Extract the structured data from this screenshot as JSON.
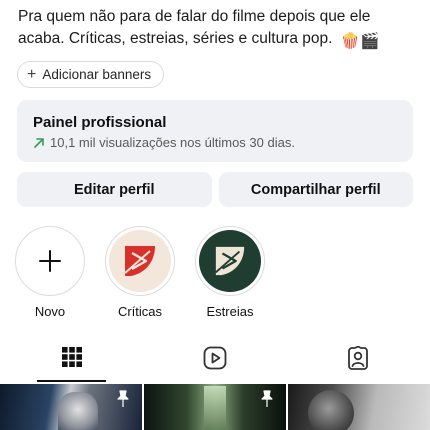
{
  "profile": {
    "bio_text": "Pra quem não para de falar do filme depois que ele acaba. Críticas, estreias, séries e cultura pop.",
    "bio_emoji": "🍿🎬"
  },
  "banner_button": {
    "label": "Adicionar banners"
  },
  "professional_panel": {
    "title": "Painel profissional",
    "subtitle": "10,1 mil visualizações nos últimos 30 dias.",
    "accent_color": "#2e9e5b"
  },
  "actions": {
    "edit_label": "Editar perfil",
    "share_label": "Compartilhar perfil"
  },
  "highlights": [
    {
      "label": "Novo",
      "icon": "plus-icon"
    },
    {
      "label": "Críticas",
      "icon": "red-logo"
    },
    {
      "label": "Estreias",
      "icon": "cream-logo-on-dark-green"
    }
  ],
  "tabs": [
    {
      "name": "posts-grid",
      "icon": "grid-icon",
      "active": true
    },
    {
      "name": "reels",
      "icon": "reels-icon",
      "active": false
    },
    {
      "name": "tagged",
      "icon": "tagged-person-icon",
      "active": false
    }
  ],
  "grid": {
    "thumbnails": [
      {
        "pinned": true,
        "icon": "pin-icon"
      },
      {
        "pinned": true,
        "icon": "pin-icon"
      },
      {
        "pinned": false
      }
    ]
  }
}
